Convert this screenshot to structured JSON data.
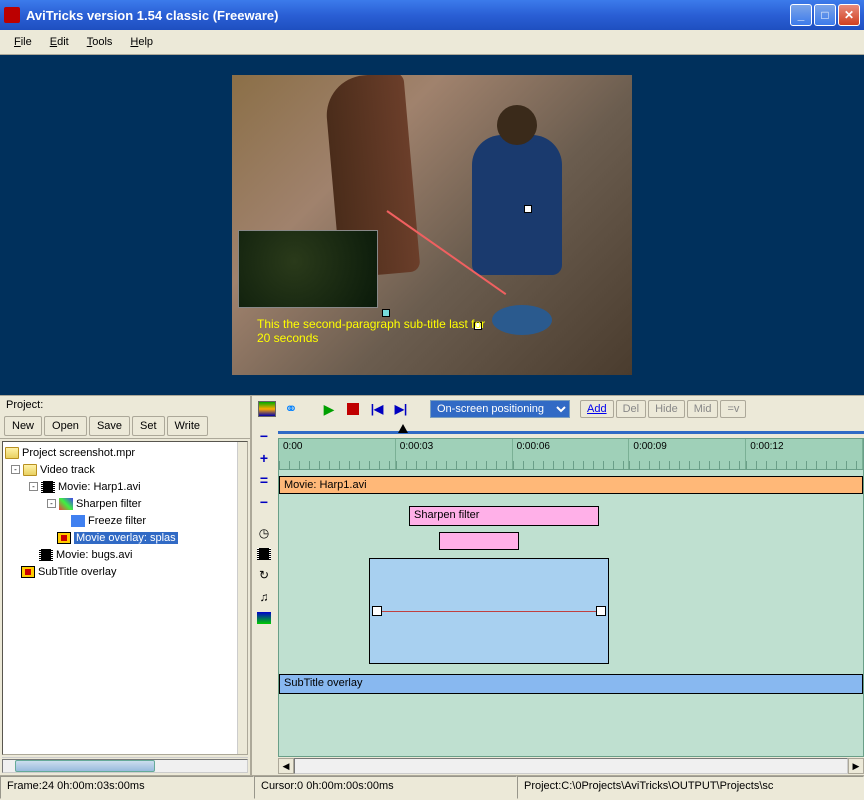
{
  "window": {
    "title": "AviTricks version 1.54 classic (Freeware)"
  },
  "menu": {
    "file": "File",
    "edit": "Edit",
    "tools": "Tools",
    "help": "Help"
  },
  "preview": {
    "subtitle_line1": "This the second-paragraph sub-title last for",
    "subtitle_line2": "20 seconds"
  },
  "project": {
    "label": "Project:",
    "buttons": {
      "new": "New",
      "open": "Open",
      "save": "Save",
      "set": "Set",
      "write": "Write"
    },
    "tree": {
      "root": "Project screenshot.mpr",
      "video_track": "Video track",
      "movie1": "Movie: Harp1.avi",
      "sharpen": "Sharpen filter",
      "freeze": "Freeze filter",
      "overlay": "Movie overlay: splas",
      "movie2": "Movie: bugs.avi",
      "subtitle": "SubTitle overlay"
    }
  },
  "timeline": {
    "mode": "On-screen positioning",
    "actions": {
      "add": "Add",
      "del": "Del",
      "hide": "Hide",
      "mid": "Mid",
      "ev": "=v"
    },
    "ticks": [
      "0:00",
      "0:00:03",
      "0:00:06",
      "0:00:09",
      "0:00:12"
    ],
    "clips": {
      "movie": "Movie: Harp1.avi",
      "sharpen": "Sharpen filter",
      "subtitle": "SubTitle overlay"
    }
  },
  "status": {
    "frame": "Frame:24  0h:00m:03s:00ms",
    "cursor": "Cursor:0   0h:00m:00s:00ms",
    "project_path": "Project:C:\\0Projects\\AviTricks\\OUTPUT\\Projects\\sc"
  }
}
